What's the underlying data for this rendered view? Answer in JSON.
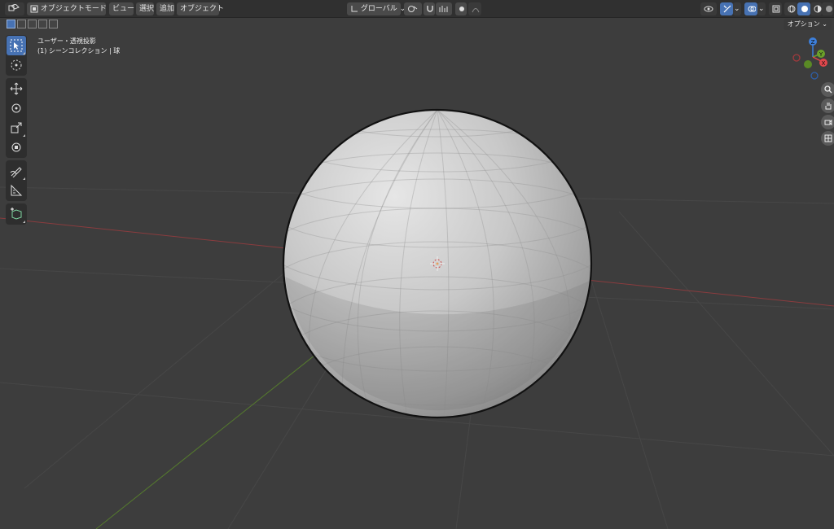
{
  "header": {
    "mode_label": "オブジェクトモード",
    "menu_view": "ビュー",
    "menu_select": "選択",
    "menu_add": "追加",
    "menu_object": "オブジェクト",
    "transform_orientation": "グローバル"
  },
  "viewport": {
    "view_name": "ユーザー・透視投影",
    "collection_info": "(1) シーンコレクション | 球",
    "options_label": "オプション"
  },
  "gizmo": {
    "z_label": "Z",
    "y_label": "Y",
    "x_label": "X"
  },
  "toolbar": {
    "tools": [
      "select-box",
      "cursor",
      "move",
      "rotate",
      "scale",
      "transform",
      "annotate",
      "measure",
      "add-cube"
    ]
  },
  "colors": {
    "accent": "#4772b3",
    "x_axis": "#e0474c",
    "y_axis": "#6ba12a",
    "z_axis": "#3d7fdb",
    "background": "#3d3d3d"
  }
}
